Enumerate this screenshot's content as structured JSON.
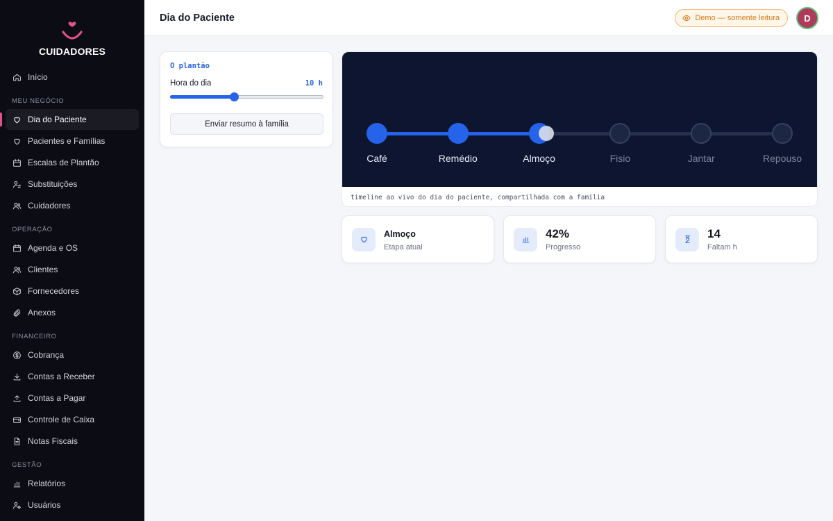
{
  "brand": {
    "name": "CUIDADORES",
    "logo_icon": "smile-heart-icon",
    "accent": "#e0528b"
  },
  "sidebar": {
    "items": [
      {
        "type": "item",
        "label": "Início",
        "icon": "home-icon",
        "name": "sidebar-item-inicio"
      },
      {
        "type": "section",
        "label": "MEU NEGÓCIO"
      },
      {
        "type": "item",
        "label": "Dia do Paciente",
        "icon": "heart-icon",
        "name": "sidebar-item-dia-do-paciente",
        "active": true
      },
      {
        "type": "item",
        "label": "Pacientes e Famílias",
        "icon": "heart-icon",
        "name": "sidebar-item-pacientes-e-familias"
      },
      {
        "type": "item",
        "label": "Escalas de Plantão",
        "icon": "calendar-icon",
        "name": "sidebar-item-escalas-de-plantao"
      },
      {
        "type": "item",
        "label": "Substituições",
        "icon": "user-swap-icon",
        "name": "sidebar-item-substituicoes"
      },
      {
        "type": "item",
        "label": "Cuidadores",
        "icon": "users-icon",
        "name": "sidebar-item-cuidadores"
      },
      {
        "type": "section",
        "label": "OPERAÇÃO"
      },
      {
        "type": "item",
        "label": "Agenda e OS",
        "icon": "calendar-icon",
        "name": "sidebar-item-agenda-e-os"
      },
      {
        "type": "item",
        "label": "Clientes",
        "icon": "users-icon",
        "name": "sidebar-item-clientes"
      },
      {
        "type": "item",
        "label": "Fornecedores",
        "icon": "box-icon",
        "name": "sidebar-item-fornecedores"
      },
      {
        "type": "item",
        "label": "Anexos",
        "icon": "paperclip-icon",
        "name": "sidebar-item-anexos"
      },
      {
        "type": "section",
        "label": "FINANCEIRO"
      },
      {
        "type": "item",
        "label": "Cobrança",
        "icon": "dollar-circle-icon",
        "name": "sidebar-item-cobranca"
      },
      {
        "type": "item",
        "label": "Contas a Receber",
        "icon": "download-icon",
        "name": "sidebar-item-contas-a-receber"
      },
      {
        "type": "item",
        "label": "Contas a Pagar",
        "icon": "upload-icon",
        "name": "sidebar-item-contas-a-pagar"
      },
      {
        "type": "item",
        "label": "Controle de Caixa",
        "icon": "wallet-icon",
        "name": "sidebar-item-controle-de-caixa"
      },
      {
        "type": "item",
        "label": "Notas Fiscais",
        "icon": "document-icon",
        "name": "sidebar-item-notas-fiscais"
      },
      {
        "type": "section",
        "label": "GESTÃO"
      },
      {
        "type": "item",
        "label": "Relatórios",
        "icon": "bar-chart-icon",
        "name": "sidebar-item-relatorios"
      },
      {
        "type": "item",
        "label": "Usuários",
        "icon": "user-gear-icon",
        "name": "sidebar-item-usuarios"
      }
    ]
  },
  "header": {
    "title": "Dia do Paciente",
    "demo_badge": "Demo — somente leitura",
    "demo_icon": "eye-icon",
    "avatar_initial": "D"
  },
  "plantao": {
    "title": "O plantão",
    "slider_label": "Hora do dia",
    "slider_value_text": "10 h",
    "slider_value": 10,
    "slider_min": 0,
    "slider_max": 24,
    "send_button": "Enviar resumo à família"
  },
  "timeline": {
    "steps": [
      "Café",
      "Remédio",
      "Almoço",
      "Fisio",
      "Jantar",
      "Repouso"
    ],
    "current_index": 2,
    "caption": "timeline ao vivo do dia do paciente, compartilhada com a família",
    "colors": {
      "background": "#0e1530",
      "done": "#2563eb",
      "todo": "#24304f"
    }
  },
  "stats": [
    {
      "value": "Almoço",
      "label": "Etapa atual",
      "icon": "heart-icon"
    },
    {
      "value": "42%",
      "label": "Progresso",
      "icon": "bar-chart-icon"
    },
    {
      "value": "14",
      "label": "Faltam h",
      "icon": "hourglass-icon"
    }
  ]
}
